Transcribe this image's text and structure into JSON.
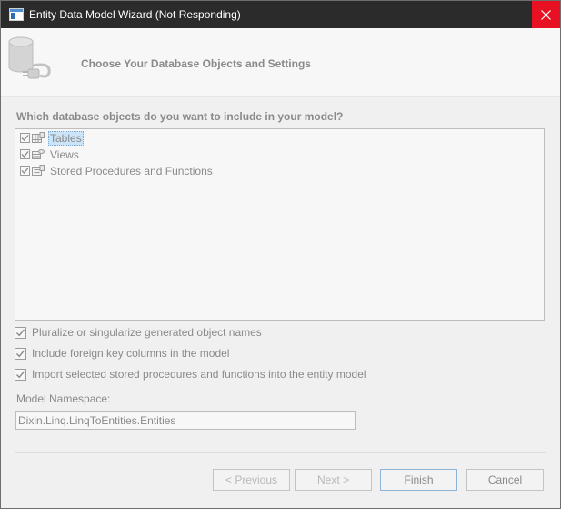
{
  "window": {
    "title": "Entity Data Model Wizard (Not Responding)",
    "close_icon": "close-icon",
    "accent_close": "#e81123"
  },
  "header": {
    "heading": "Choose Your Database Objects and Settings",
    "icon": "database-connector-icon"
  },
  "objects": {
    "question": "Which database objects do you want to include in your model?",
    "items": [
      {
        "label": "Tables",
        "checked": true,
        "selected": true,
        "icon": "table-icon"
      },
      {
        "label": "Views",
        "checked": true,
        "selected": false,
        "icon": "view-icon"
      },
      {
        "label": "Stored Procedures and Functions",
        "checked": true,
        "selected": false,
        "icon": "stored-procedure-icon"
      }
    ]
  },
  "options": [
    {
      "label": "Pluralize or singularize generated object names",
      "checked": true
    },
    {
      "label": "Include foreign key columns in the model",
      "checked": true
    },
    {
      "label": "Import selected stored procedures and functions into the entity model",
      "checked": true
    }
  ],
  "namespace": {
    "label": "Model Namespace:",
    "value": "Dixin.Linq.LinqToEntities.Entities"
  },
  "buttons": {
    "previous": "< Previous",
    "next": "Next >",
    "finish": "Finish",
    "cancel": "Cancel"
  }
}
